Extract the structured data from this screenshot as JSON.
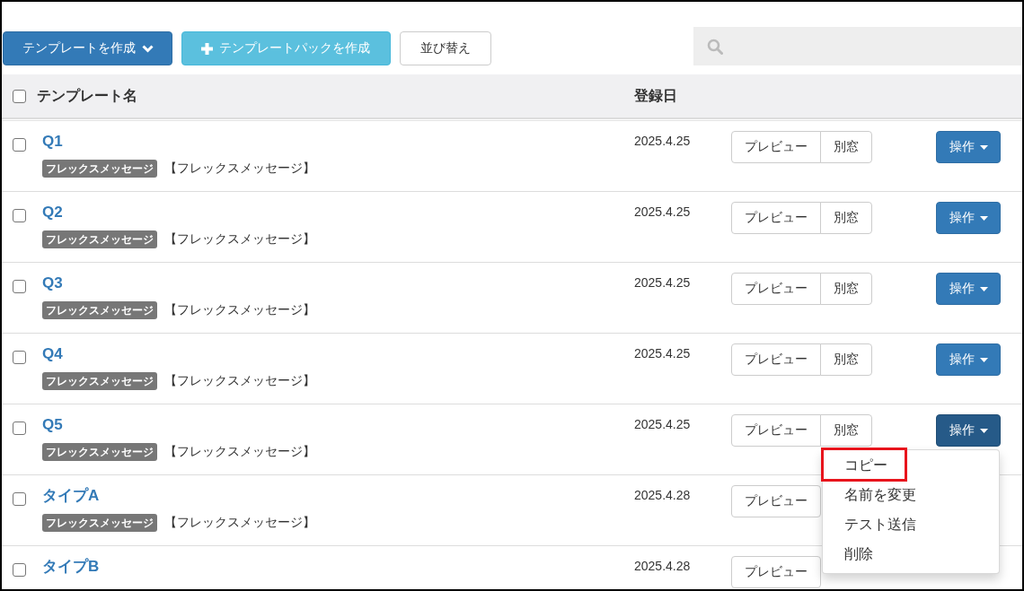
{
  "toolbar": {
    "buttons": [
      {
        "kind": "dropdown",
        "label": "テンプレートを作成"
      },
      {
        "kind": "add",
        "label": "テンプレートパックを作成"
      },
      {
        "kind": "plain",
        "label": "並び替え"
      }
    ],
    "search": true
  },
  "table": {
    "header": {
      "checked": false,
      "columns": [
        "テンプレート名",
        "登録日"
      ]
    },
    "rows": [
      {
        "checked": false,
        "name": "Q1",
        "badge": "フレックスメッセージ",
        "description": "【フレックスメッセージ】",
        "date": "2025.4.25",
        "buttons": [
          "プレビュー",
          "別窓"
        ],
        "actions": {
          "label": "操作",
          "open": false
        }
      },
      {
        "checked": false,
        "name": "Q2",
        "badge": "フレックスメッセージ",
        "description": "【フレックスメッセージ】",
        "date": "2025.4.25",
        "buttons": [
          "プレビュー",
          "別窓"
        ],
        "actions": {
          "label": "操作",
          "open": false
        }
      },
      {
        "checked": false,
        "name": "Q3",
        "badge": "フレックスメッセージ",
        "description": "【フレックスメッセージ】",
        "date": "2025.4.25",
        "buttons": [
          "プレビュー",
          "別窓"
        ],
        "actions": {
          "label": "操作",
          "open": false
        }
      },
      {
        "checked": false,
        "name": "Q4",
        "badge": "フレックスメッセージ",
        "description": "【フレックスメッセージ】",
        "date": "2025.4.25",
        "buttons": [
          "プレビュー",
          "別窓"
        ],
        "actions": {
          "label": "操作",
          "open": false
        }
      },
      {
        "checked": false,
        "name": "Q5",
        "badge": "フレックスメッセージ",
        "description": "【フレックスメッセージ】",
        "date": "2025.4.25",
        "buttons": [
          "プレビュー",
          "別窓"
        ],
        "actions": {
          "label": "操作",
          "open": true,
          "menu": [
            {
              "label": "コピー",
              "highlighted": true
            },
            {
              "label": "名前を変更",
              "highlighted": false
            },
            {
              "label": "テスト送信",
              "highlighted": false
            },
            {
              "label": "削除",
              "highlighted": false
            }
          ]
        }
      },
      {
        "checked": false,
        "name": "タイプA",
        "badge": "フレックスメッセージ",
        "description": "【フレックスメッセージ】",
        "date": "2025.4.28",
        "buttons": [
          "プレビュー"
        ]
      },
      {
        "checked": false,
        "name": "タイプB",
        "date": "2025.4.28",
        "buttons": [
          "プレビュー"
        ]
      }
    ]
  }
}
